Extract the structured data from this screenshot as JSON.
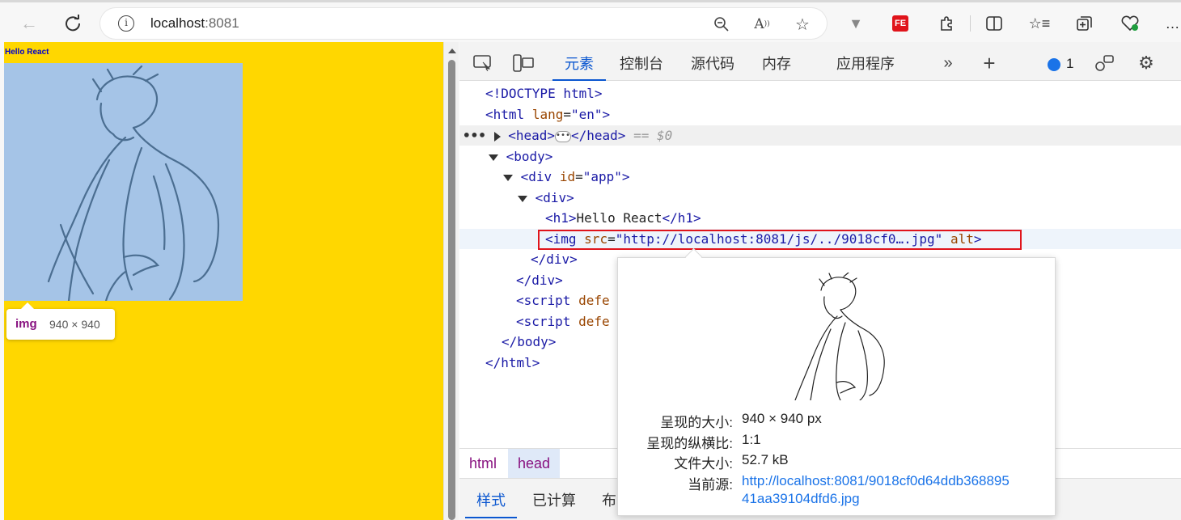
{
  "browser": {
    "url_host": "localhost",
    "url_port": ":8081",
    "extension_label": "FE"
  },
  "page": {
    "heading": "Hello React",
    "tooltip_tag": "img",
    "tooltip_dims": "940 × 940",
    "bg_color": "#ffd700",
    "image_bg_color": "#a5c4e7"
  },
  "devtools": {
    "tabs": [
      "元素",
      "控制台",
      "源代码",
      "内存",
      "应用程序"
    ],
    "active_tab": "元素",
    "issues_count": "1",
    "dom_lines": {
      "doctype": "<!DOCTYPE html>",
      "html_open": "<html",
      "html_attr": "lang",
      "html_val": "\"en\"",
      "head_open": "<head>",
      "head_close": "</head>",
      "head_marker": "== $0",
      "body_open": "<body>",
      "div_open": "<div",
      "div_attr": "id",
      "div_val": "\"app\"",
      "div2_open": "<div>",
      "h1_open": "<h1>",
      "h1_text": "Hello React",
      "h1_close": "</h1>",
      "img_open": "<img",
      "img_attr": "src",
      "img_val": "\"http://localhost:8081/js/../9018cf0….jpg\"",
      "img_alt": "alt",
      "img_close": ">",
      "div_close": "</div>",
      "script_open": "<script",
      "script_attr": "defe",
      "body_close": "</body>",
      "html_close": "</html>"
    },
    "breadcrumbs": [
      "html",
      "head"
    ],
    "subtabs": [
      "样式",
      "已计算",
      "布"
    ]
  },
  "preview": {
    "rendered_size_label": "呈现的大小:",
    "rendered_size_value": "940 × 940 px",
    "aspect_label": "呈现的纵横比:",
    "aspect_value": "1:1",
    "filesize_label": "文件大小:",
    "filesize_value": "52.7 kB",
    "source_label": "当前源:",
    "source_value_line1": "http://localhost:8081/9018cf0d64ddb368895",
    "source_value_line2": "41aa39104dfd6.jpg"
  }
}
